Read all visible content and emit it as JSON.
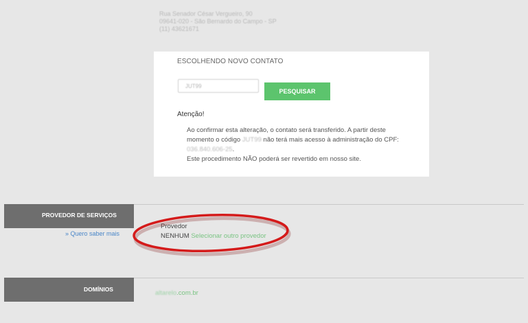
{
  "address": {
    "line1": "Rua Senador César Vergueiro, 90",
    "line2": "09641-020 - São Bernardo do Campo - SP",
    "line3": "(11) 43621671   "
  },
  "card": {
    "title": "ESCOLHENDO NOVO CONTATO",
    "input_value": "JUT99",
    "search_label": "PESQUISAR",
    "warning_title": "Atenção!",
    "warning_part1": "Ao confirmar esta alteração, o contato será transferido. A partir deste momento o código ",
    "warning_code": "JUT99",
    "warning_part2": " não terá mais acesso à administração do CPF: ",
    "warning_cpf": "036.840.606-25",
    "warning_part3": ".",
    "warning_line4": "Este procedimento NÃO poderá ser revertido em nosso site."
  },
  "provedor": {
    "section_label": "PROVEDOR DE SERVIÇOS",
    "saber_link": "» Quero saber mais",
    "label": "Provedor",
    "value": "NENHUM",
    "select_link": "Selecionar outro provedor"
  },
  "dominios": {
    "section_label": "DOMÍNIOS",
    "domain_name": "altarelo",
    "domain_suffix": ".com.br"
  },
  "colors": {
    "accent_green": "#5cc46d",
    "link_blue": "#4a86c8",
    "section_gray": "#6e6e6e",
    "annotation_red": "#d41b1b"
  }
}
